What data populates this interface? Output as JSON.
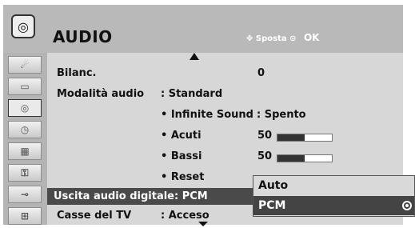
{
  "header": {
    "title": "AUDIO",
    "icon": "audio-disc-icon",
    "hint_move": "Sposta",
    "hint_ok": "OK"
  },
  "sidebar": {
    "items": [
      {
        "name": "satellite-dish-icon",
        "glyph": "☄"
      },
      {
        "name": "monitor-icon",
        "glyph": "▭"
      },
      {
        "name": "audio-disc-icon",
        "glyph": "◎",
        "active": true
      },
      {
        "name": "clock-icon",
        "glyph": "◷"
      },
      {
        "name": "calendar-icon",
        "glyph": "▦"
      },
      {
        "name": "lock-icon",
        "glyph": "🔒"
      },
      {
        "name": "input-plug-icon",
        "glyph": "⊸"
      },
      {
        "name": "usb-icon",
        "glyph": "⊞"
      }
    ]
  },
  "menu": {
    "balance": {
      "label": "Bilanc.",
      "value": "0"
    },
    "sound_mode": {
      "label": "Modalità audio",
      "value": ": Standard"
    },
    "infinite_sound": {
      "label": "• Infinite Sound",
      "value": ": Spento"
    },
    "treble": {
      "label": "• Acuti",
      "value": "50",
      "level": 0.5
    },
    "bass": {
      "label": "• Bassi",
      "value": "50",
      "level": 0.5
    },
    "reset": {
      "label": "• Reset"
    },
    "digital_out": {
      "label": "Uscita audio digitale",
      "value": ": PCM"
    },
    "tv_speaker": {
      "label": "Casse del TV",
      "value": ": Acceso"
    }
  },
  "dropdown": {
    "options": [
      "Auto",
      "PCM"
    ],
    "selected": "PCM"
  },
  "colors": {
    "frame": "#d7d7d7",
    "header": "#b9b9b9",
    "sidebar": "#b4b4b4",
    "highlight": "#4a4a4a",
    "dropdown_selected": "#444444"
  }
}
